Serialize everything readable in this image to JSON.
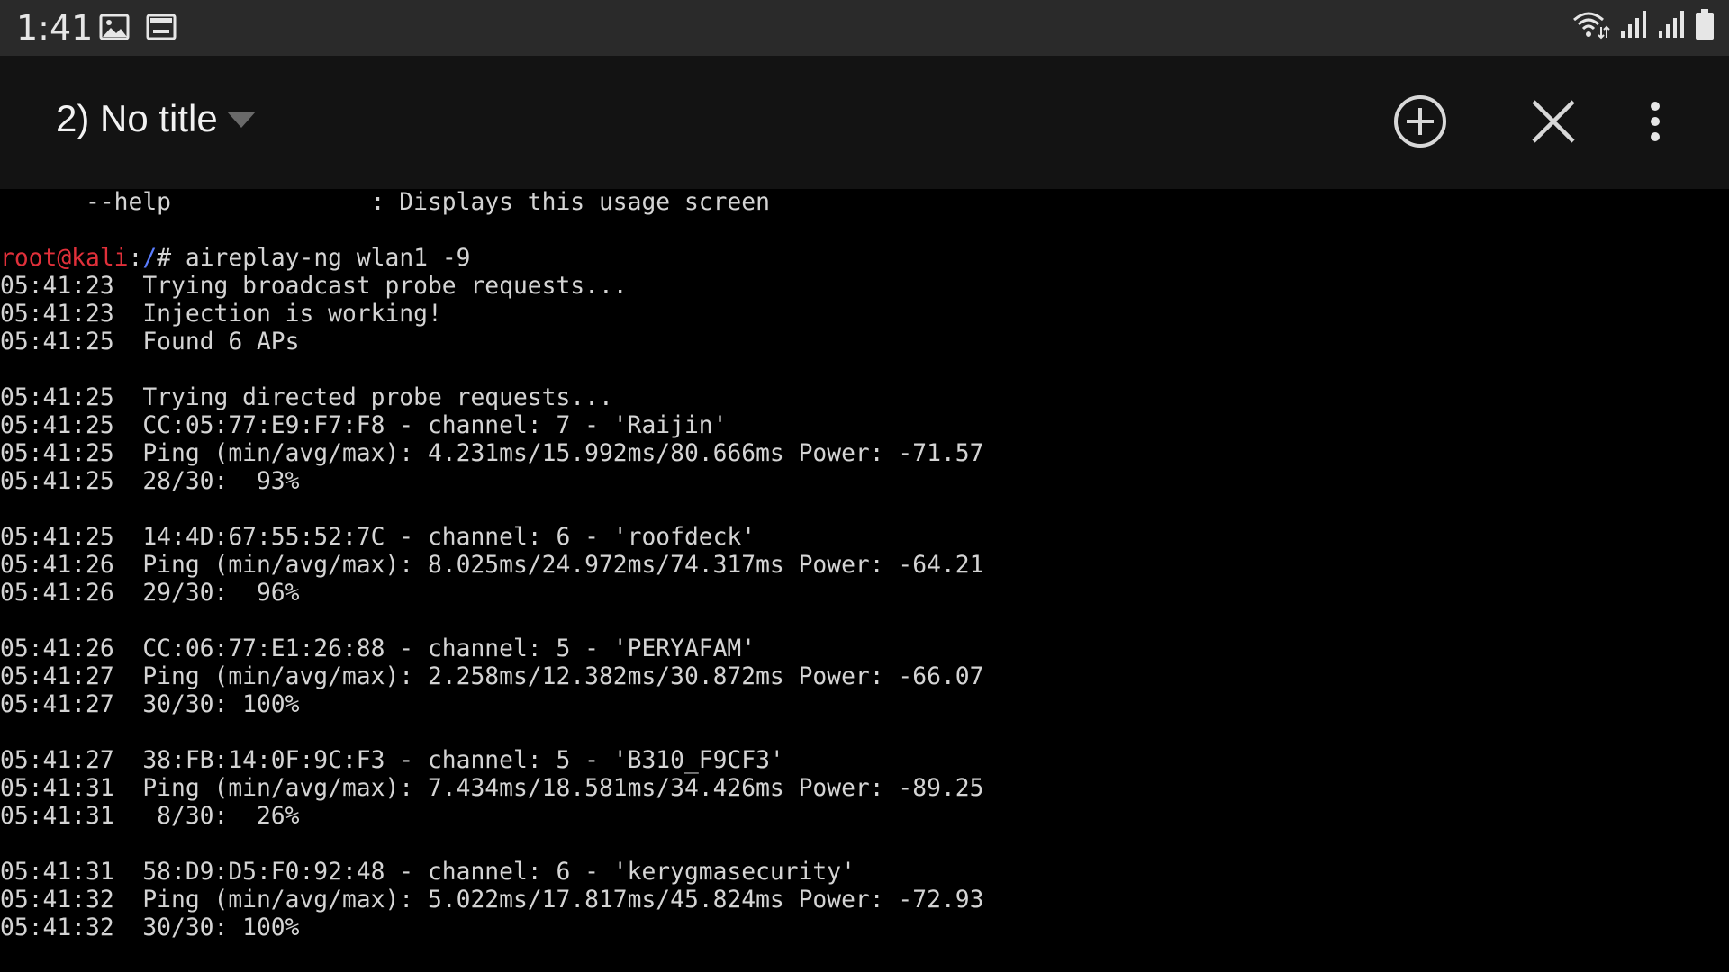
{
  "status_bar": {
    "time": "1:41",
    "left_icons": [
      "gallery-icon",
      "terminal-notification-icon"
    ],
    "right_icons": [
      "wifi-icon",
      "signal-1-icon",
      "signal-2-icon",
      "battery-icon"
    ]
  },
  "app_bar": {
    "tab_title": "2) No title",
    "actions": [
      "add-session-icon",
      "close-session-icon",
      "more-options-icon"
    ]
  },
  "terminal": {
    "prompt": {
      "user_host": "root@kali",
      "separator": ":",
      "path": "/",
      "symbol": "# ",
      "command": "aireplay-ng wlan1 -9"
    },
    "lines": [
      "      --help              : Displays this usage screen",
      "",
      "__PROMPT__",
      "05:41:23  Trying broadcast probe requests...",
      "05:41:23  Injection is working!",
      "05:41:25  Found 6 APs",
      "",
      "05:41:25  Trying directed probe requests...",
      "05:41:25  CC:05:77:E9:F7:F8 - channel: 7 - 'Raijin'",
      "05:41:25  Ping (min/avg/max): 4.231ms/15.992ms/80.666ms Power: -71.57",
      "05:41:25  28/30:  93%",
      "",
      "05:41:25  14:4D:67:55:52:7C - channel: 6 - 'roofdeck'",
      "05:41:26  Ping (min/avg/max): 8.025ms/24.972ms/74.317ms Power: -64.21",
      "05:41:26  29/30:  96%",
      "",
      "05:41:26  CC:06:77:E1:26:88 - channel: 5 - 'PERYAFAM'",
      "05:41:27  Ping (min/avg/max): 2.258ms/12.382ms/30.872ms Power: -66.07",
      "05:41:27  30/30: 100%",
      "",
      "05:41:27  38:FB:14:0F:9C:F3 - channel: 5 - 'B310_F9CF3'",
      "05:41:31  Ping (min/avg/max): 7.434ms/18.581ms/34.426ms Power: -89.25",
      "05:41:31   8/30:  26%",
      "",
      "05:41:31  58:D9:D5:F0:92:48 - channel: 6 - 'kerygmasecurity'",
      "05:41:32  Ping (min/avg/max): 5.022ms/17.817ms/45.824ms Power: -72.93",
      "05:41:32  30/30: 100%"
    ]
  },
  "colors": {
    "background": "#000000",
    "status_bar": "#2a2a2a",
    "app_bar": "#131313",
    "terminal_text": "#d4d4d4",
    "prompt_user": "#e0303a",
    "prompt_path": "#5a7dff"
  }
}
